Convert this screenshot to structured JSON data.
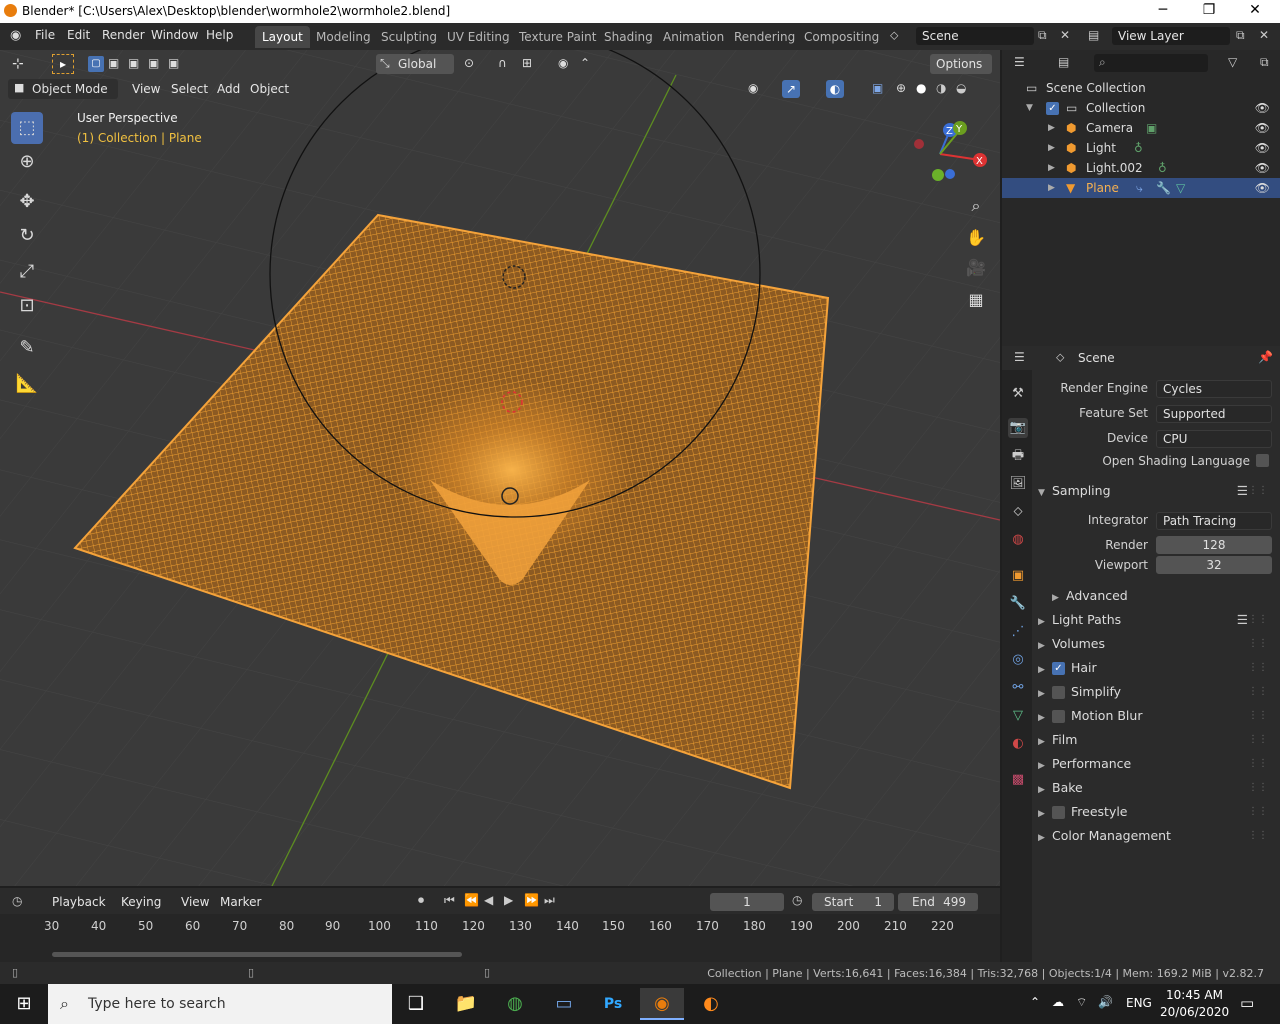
{
  "window": {
    "title": "Blender* [C:\\Users\\Alex\\Desktop\\blender\\wormhole2\\wormhole2.blend]",
    "min": "─",
    "max": "❐",
    "close": "✕"
  },
  "menu": {
    "file": "File",
    "edit": "Edit",
    "render": "Render",
    "window": "Window",
    "help": "Help"
  },
  "workspaces": [
    "Layout",
    "Modeling",
    "Sculpting",
    "UV Editing",
    "Texture Paint",
    "Shading",
    "Animation",
    "Rendering",
    "Compositing"
  ],
  "scene_field": "Scene",
  "view_layer_field": "View Layer",
  "viewport": {
    "transform_orientation": "Global",
    "options": "Options",
    "mode": "Object Mode",
    "menu_view": "View",
    "menu_select": "Select",
    "menu_add": "Add",
    "menu_object": "Object",
    "overlay_title": "User Perspective",
    "overlay_sub": "(1) Collection | Plane",
    "gizmo": {
      "x": "X",
      "y": "Y",
      "z": "Z"
    }
  },
  "outliner": {
    "root": "Scene Collection",
    "collection": "Collection",
    "items": [
      {
        "label": "Camera",
        "icon": "camera-icon"
      },
      {
        "label": "Light",
        "icon": "light-icon"
      },
      {
        "label": "Light.002",
        "icon": "light-icon"
      },
      {
        "label": "Plane",
        "icon": "mesh-icon"
      }
    ]
  },
  "properties": {
    "context": "Scene",
    "render_engine_label": "Render Engine",
    "render_engine": "Cycles",
    "feature_set_label": "Feature Set",
    "feature_set": "Supported",
    "device_label": "Device",
    "device": "CPU",
    "osl_label": "Open Shading Language",
    "sampling": "Sampling",
    "integrator_label": "Integrator",
    "integrator": "Path Tracing",
    "render_label": "Render",
    "render_samples": "128",
    "viewport_label": "Viewport",
    "viewport_samples": "32",
    "advanced": "Advanced",
    "panels": {
      "light_paths": "Light Paths",
      "volumes": "Volumes",
      "hair": "Hair",
      "simplify": "Simplify",
      "motion_blur": "Motion Blur",
      "film": "Film",
      "performance": "Performance",
      "bake": "Bake",
      "freestyle": "Freestyle",
      "color_management": "Color Management"
    }
  },
  "timeline": {
    "playback": "Playback",
    "keying": "Keying",
    "view": "View",
    "marker": "Marker",
    "current_frame": "1",
    "start_label": "Start",
    "start": "1",
    "end_label": "End",
    "end": "499",
    "ticks": [
      "30",
      "40",
      "50",
      "60",
      "70",
      "80",
      "90",
      "100",
      "110",
      "120",
      "130",
      "140",
      "150",
      "160",
      "170",
      "180",
      "190",
      "200",
      "210",
      "220"
    ]
  },
  "status": "Collection | Plane | Verts:16,641 | Faces:16,384 | Tris:32,768 | Objects:1/4 | Mem: 169.2 MiB | v2.82.7",
  "taskbar": {
    "search_placeholder": "Type here to search",
    "lang": "ENG",
    "time": "10:45 AM",
    "date": "20/06/2020"
  },
  "colors": {
    "accent": "#4772b3",
    "selection": "#334d80",
    "mesh": "#f5a33a",
    "x_axis": "#c23b46",
    "y_axis": "#6a9a23"
  }
}
